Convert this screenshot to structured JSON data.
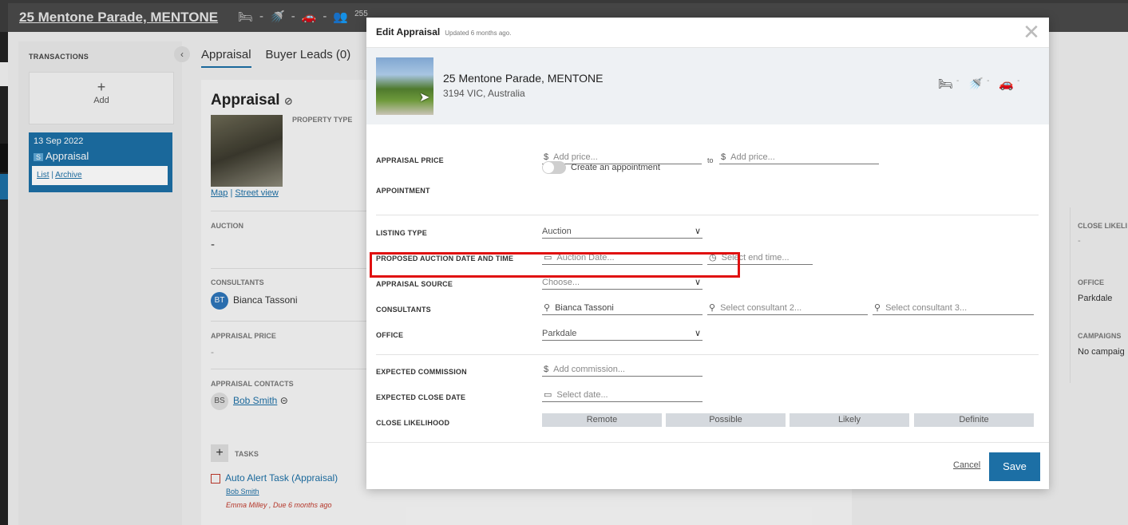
{
  "background": {
    "property_title": "25 Mentone Parade, MENTONE",
    "top_count": "255",
    "sidebar": {
      "heading": "TRANSACTIONS",
      "add_label": "Add",
      "card": {
        "date": "13 Sep 2022",
        "badge": "S",
        "name": "Appraisal",
        "link_list": "List",
        "link_archive": "Archive"
      }
    },
    "tabs": [
      "Appraisal",
      "Buyer Leads (0)"
    ],
    "main": {
      "title": "Appraisal",
      "property_type_label": "PROPERTY TYPE",
      "map_link": "Map",
      "street_view_link": "Street view",
      "auction_label": "AUCTION",
      "auction_value": "-",
      "consultants_label": "CONSULTANTS",
      "consultant_initials": "BT",
      "consultant_name": "Bianca Tassoni",
      "appraisal_price_label": "APPRAISAL PRICE",
      "appraisal_price_value": "-",
      "contacts_label": "APPRAISAL CONTACTS",
      "contact_initials": "BS",
      "contact_name": "Bob Smith",
      "tasks_label": "TASKS",
      "task_name": "Auto Alert Task (Appraisal)",
      "task_user": "Bob Smith",
      "task_due": "Emma Milley , Due 6 months ago"
    },
    "right_col": {
      "close_label": "CLOSE LIKELI",
      "close_value": "-",
      "office_label": "OFFICE",
      "office_value": "Parkdale",
      "campaigns_label": "CAMPAIGNS",
      "campaigns_value": "No campaig"
    }
  },
  "modal": {
    "title": "Edit Appraisal",
    "updated": "Updated 6 months ago.",
    "property": {
      "address_line1": "25 Mentone Parade, MENTONE",
      "address_line2": "3194 VIC, Australia"
    },
    "fields": {
      "appraisal_price_label": "APPRAISAL PRICE",
      "currency": "$",
      "price_from_placeholder": "Add price...",
      "to_text": "to",
      "price_to_placeholder": "Add price...",
      "appointment_label": "APPOINTMENT",
      "appointment_toggle_label": "Create an appointment",
      "listing_type_label": "LISTING TYPE",
      "listing_type_value": "Auction",
      "auction_date_label": "PROPOSED AUCTION DATE AND TIME",
      "auction_date_placeholder": "Auction Date...",
      "end_time_placeholder": "Select end time...",
      "appraisal_source_label": "APPRAISAL SOURCE",
      "appraisal_source_value": "Choose...",
      "consultants_label": "CONSULTANTS",
      "consultant1": "Bianca Tassoni",
      "consultant2_placeholder": "Select consultant 2...",
      "consultant3_placeholder": "Select consultant 3...",
      "office_label": "OFFICE",
      "office_value": "Parkdale",
      "commission_label": "EXPECTED COMMISSION",
      "commission_placeholder": "Add commission...",
      "close_date_label": "EXPECTED CLOSE DATE",
      "close_date_placeholder": "Select date...",
      "close_likelihood_label": "CLOSE LIKELIHOOD",
      "likelihood_options": [
        "Remote",
        "Possible",
        "Likely",
        "Definite"
      ]
    },
    "footer": {
      "cancel": "Cancel",
      "save": "Save"
    }
  },
  "colors": {
    "accent": "#1c6fa5",
    "highlight": "#e01010"
  }
}
